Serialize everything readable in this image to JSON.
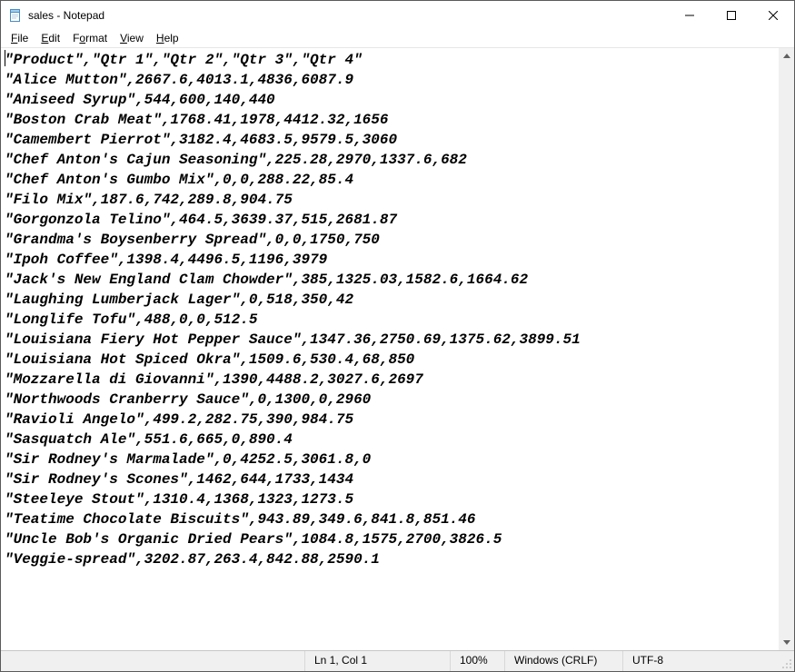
{
  "window": {
    "title": "sales - Notepad"
  },
  "menu": {
    "file": "File",
    "edit": "Edit",
    "format": "Format",
    "view": "View",
    "help": "Help"
  },
  "content": "\"Product\",\"Qtr 1\",\"Qtr 2\",\"Qtr 3\",\"Qtr 4\"\n\"Alice Mutton\",2667.6,4013.1,4836,6087.9\n\"Aniseed Syrup\",544,600,140,440\n\"Boston Crab Meat\",1768.41,1978,4412.32,1656\n\"Camembert Pierrot\",3182.4,4683.5,9579.5,3060\n\"Chef Anton's Cajun Seasoning\",225.28,2970,1337.6,682\n\"Chef Anton's Gumbo Mix\",0,0,288.22,85.4\n\"Filo Mix\",187.6,742,289.8,904.75\n\"Gorgonzola Telino\",464.5,3639.37,515,2681.87\n\"Grandma's Boysenberry Spread\",0,0,1750,750\n\"Ipoh Coffee\",1398.4,4496.5,1196,3979\n\"Jack's New England Clam Chowder\",385,1325.03,1582.6,1664.62\n\"Laughing Lumberjack Lager\",0,518,350,42\n\"Longlife Tofu\",488,0,0,512.5\n\"Louisiana Fiery Hot Pepper Sauce\",1347.36,2750.69,1375.62,3899.51\n\"Louisiana Hot Spiced Okra\",1509.6,530.4,68,850\n\"Mozzarella di Giovanni\",1390,4488.2,3027.6,2697\n\"Northwoods Cranberry Sauce\",0,1300,0,2960\n\"Ravioli Angelo\",499.2,282.75,390,984.75\n\"Sasquatch Ale\",551.6,665,0,890.4\n\"Sir Rodney's Marmalade\",0,4252.5,3061.8,0\n\"Sir Rodney's Scones\",1462,644,1733,1434\n\"Steeleye Stout\",1310.4,1368,1323,1273.5\n\"Teatime Chocolate Biscuits\",943.89,349.6,841.8,851.46\n\"Uncle Bob's Organic Dried Pears\",1084.8,1575,2700,3826.5\n\"Veggie-spread\",3202.87,263.4,842.88,2590.1",
  "status": {
    "position": "Ln 1, Col 1",
    "zoom": "100%",
    "eol": "Windows (CRLF)",
    "encoding": "UTF-8"
  }
}
